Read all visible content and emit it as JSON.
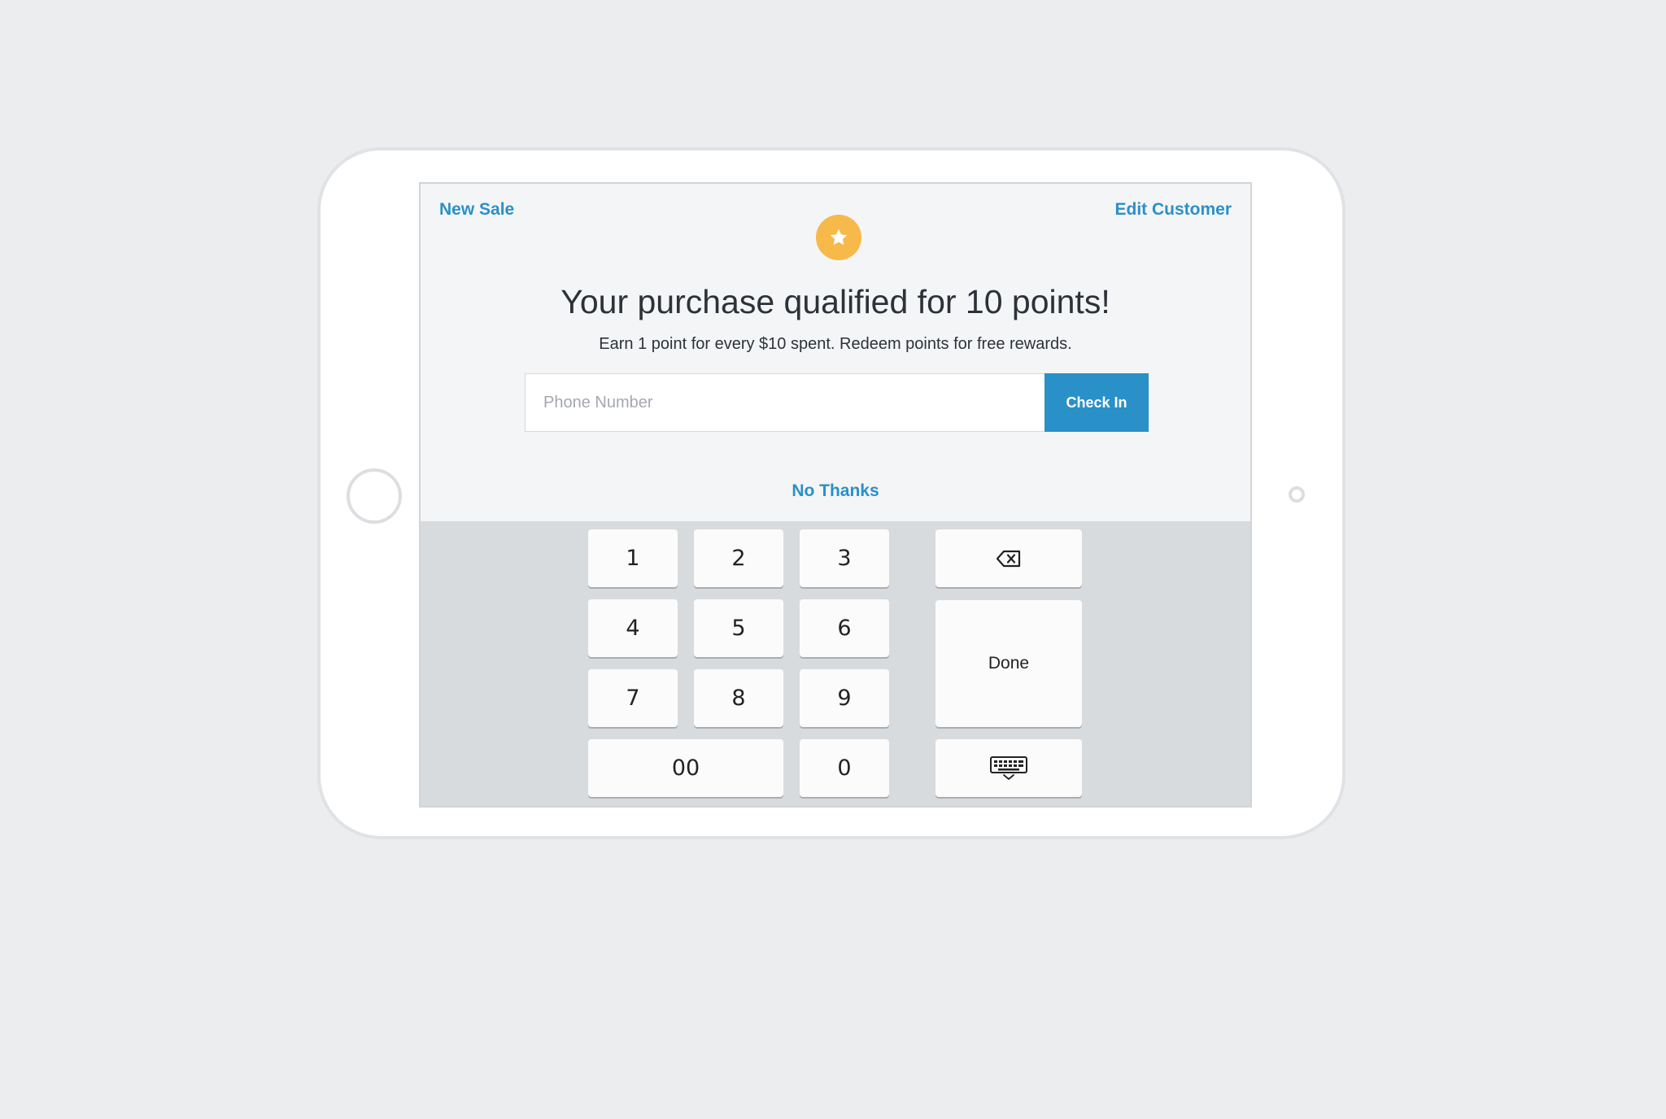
{
  "header": {
    "left_link": "New Sale",
    "right_link": "Edit Customer"
  },
  "badge": {
    "icon": "star-icon",
    "color": "#f6b94a"
  },
  "content": {
    "headline": "Your purchase qualified for 10 points!",
    "subline": "Earn 1 point for every $10 spent. Redeem points for free rewards."
  },
  "phone_field": {
    "placeholder": "Phone Number",
    "value": ""
  },
  "check_in_button": {
    "label": "Check In",
    "color": "#2a90c8"
  },
  "no_thanks": {
    "label": "No Thanks"
  },
  "keypad": {
    "keys": [
      "1",
      "2",
      "3",
      "4",
      "5",
      "6",
      "7",
      "8",
      "9",
      "00",
      "0"
    ],
    "done_label": "Done",
    "backspace_icon": "backspace-icon",
    "hide_keyboard_icon": "keyboard-hide-icon"
  }
}
